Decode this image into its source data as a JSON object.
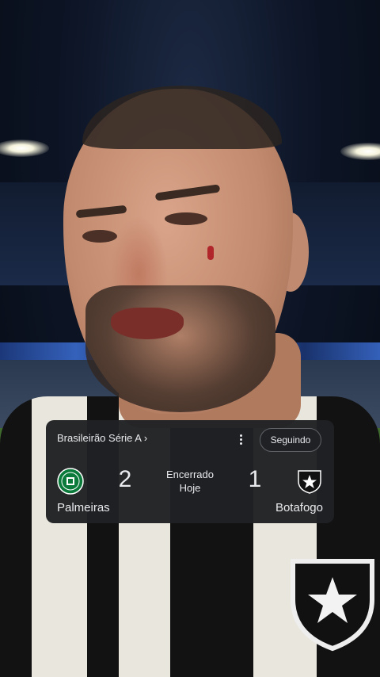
{
  "match_card": {
    "league": "Brasileirão Série A ›",
    "follow_label": "Seguindo",
    "status": "Encerrado",
    "date": "Hoje",
    "home": {
      "name": "Palmeiras",
      "score": "2",
      "logo_icon": "palmeiras-crest-icon",
      "logo_color": "#0b7a3b"
    },
    "away": {
      "name": "Botafogo",
      "score": "1",
      "logo_icon": "botafogo-crest-icon",
      "logo_color": "#111111"
    }
  },
  "colors": {
    "card_bg": "#202124",
    "card_text": "#e8eaed",
    "follow_border": "#5f6368"
  }
}
